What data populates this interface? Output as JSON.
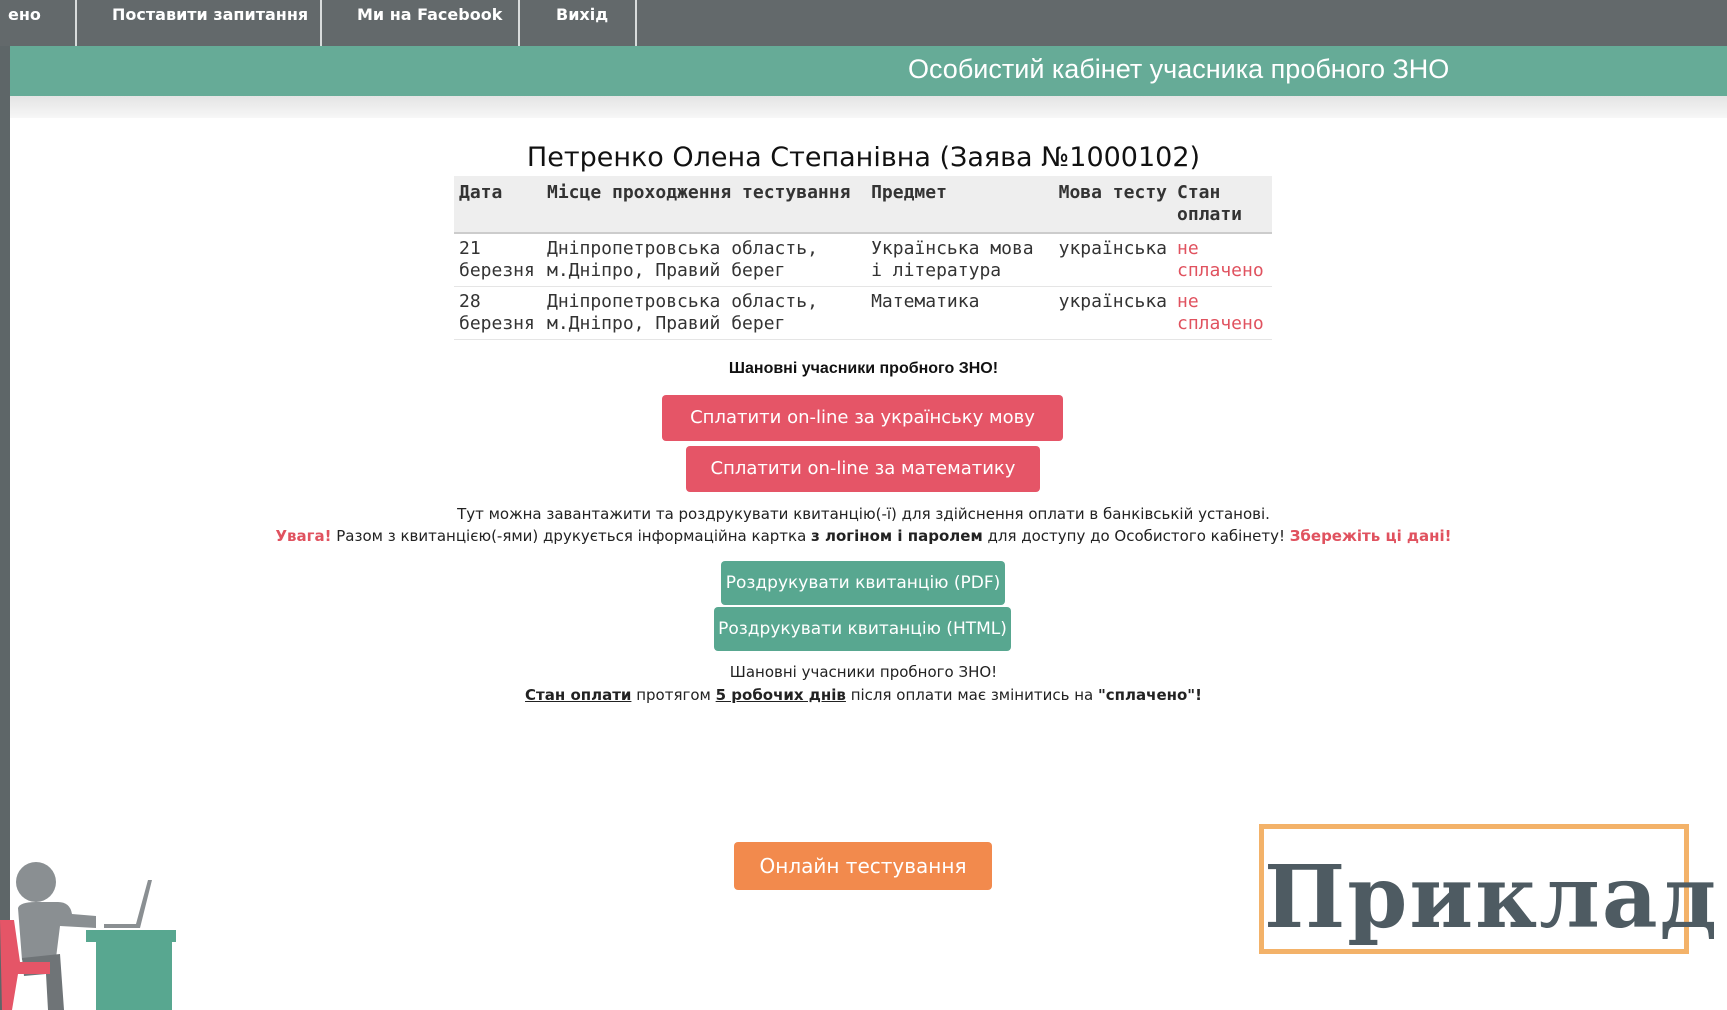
{
  "nav": {
    "items": [
      {
        "label": "ено"
      },
      {
        "label": "Поставити запитання"
      },
      {
        "label": "Ми на Facebook"
      },
      {
        "label": "Вихід"
      }
    ]
  },
  "banner": {
    "title": "Особистий кабінет учасника пробного ЗНО"
  },
  "user": {
    "title": "Петренко Олена Степанівна (Заява №1000102)"
  },
  "table": {
    "headers": [
      "Дата",
      "Місце проходження тестування",
      "Предмет",
      "Мова тесту",
      "Стан оплати"
    ],
    "rows": [
      {
        "date": "21 березня",
        "place": "Дніпропетровська область, м.Дніпро, Правий берег",
        "subject": "Українська мова і література",
        "language": "українська",
        "status": "не сплачено"
      },
      {
        "date": "28 березня",
        "place": "Дніпропетровська область, м.Дніпро, Правий берег",
        "subject": "Математика",
        "language": "українська",
        "status": "не сплачено"
      }
    ]
  },
  "notice": {
    "greeting": "Шановні учасники пробного ЗНО!"
  },
  "pay_buttons": {
    "ukrainian": "Сплатити on-line за українську мову",
    "math": "Сплатити on-line за математику"
  },
  "receipt_info": {
    "line1": "Тут можна завантажити та роздрукувати квитанцію(-ї) для здійснення оплати в банківській установі.",
    "warning_label": "Увага!",
    "line2_part1": " Разом з квитанцією(-ями) друкується інформаційна картка ",
    "line2_bold": "з логіном і паролем",
    "line2_part2": " для доступу до Особистого кабінету! ",
    "save_note": "Збережіть ці дані!"
  },
  "print_buttons": {
    "pdf": "Роздрукувати квитанцію (PDF)",
    "html": "Роздрукувати квитанцію (HTML)"
  },
  "status_info": {
    "greeting": "Шановні учасники пробного ЗНО!",
    "status_label": "Стан оплати",
    "text1": " протягом ",
    "days": "5 робочих днів",
    "text2": " після оплати має змінитись на ",
    "paid": "\"сплачено\"!"
  },
  "online_test": {
    "label": "Онлайн тестування"
  },
  "stamp": {
    "text": "Приклад"
  },
  "colors": {
    "banner": "#66ab97",
    "nav": "#63696b",
    "pay_button": "#e55567",
    "print_button": "#58a790",
    "online_button": "#f28a4d",
    "unpaid": "#e0525f"
  }
}
